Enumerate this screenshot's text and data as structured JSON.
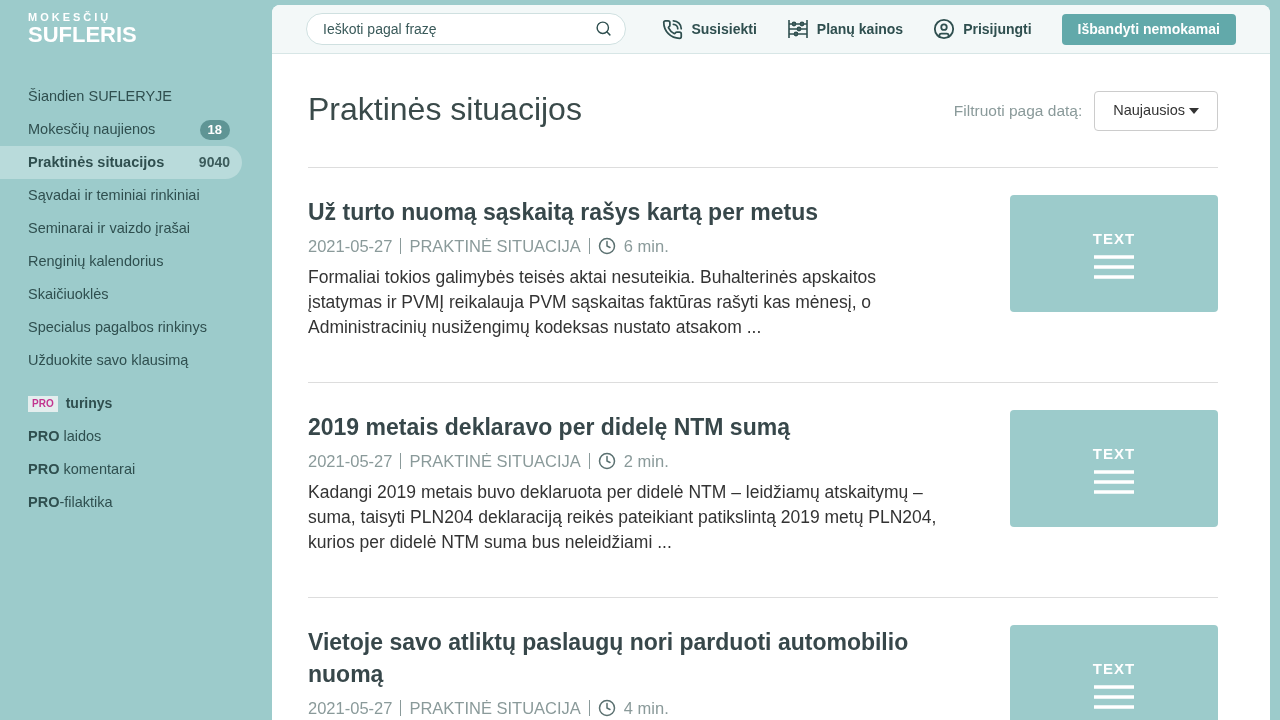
{
  "logo": {
    "top": "MOKESČIŲ",
    "bottom": "SUFLERIS"
  },
  "sidebar": {
    "items": [
      {
        "label": "Šiandien SUFLERYJE",
        "selected": false
      },
      {
        "label": "Mokesčių naujienos",
        "selected": false,
        "count": {
          "text": "18",
          "kind": "pill"
        }
      },
      {
        "label": "Praktinės situacijos",
        "selected": true,
        "count": {
          "text": "9040",
          "kind": "plain"
        }
      },
      {
        "label": "Sąvadai ir teminiai rinkiniai",
        "selected": false
      },
      {
        "label": "Seminarai ir vaizdo įrašai",
        "selected": false
      },
      {
        "label": "Renginių kalendorius",
        "selected": false
      },
      {
        "label": "Skaičiuoklės",
        "selected": false
      },
      {
        "label": "Specialus pagalbos rinkinys",
        "selected": false
      },
      {
        "label": "Užduokite savo klausimą",
        "selected": false
      }
    ],
    "pro_section": {
      "tag": "PRO",
      "title": "turinys",
      "items": [
        "**PRO** laidos",
        "**PRO** komentarai",
        "**PRO**-filaktika"
      ]
    }
  },
  "header": {
    "search": {
      "placeholder": "Ieškoti pagal frazę"
    },
    "links": [
      {
        "label": "Susisiekti",
        "kind": "phone"
      },
      {
        "label": "Planų kainos",
        "kind": "abacus"
      },
      {
        "label": "Prisijungti",
        "kind": "user"
      }
    ],
    "cta": "Išbandyti nemokamai"
  },
  "page": {
    "title": "Praktinės situacijos",
    "filter": {
      "label": "Filtruoti paga datą:",
      "value": "Naujausios"
    }
  },
  "articles": [
    {
      "title": "Už turto nuomą sąskaitą rašys kartą per metus",
      "date": "2021-05-27",
      "category": "PRAKTINĖ SITUACIJA",
      "read_time": "6 min.",
      "excerpt": "Formaliai tokios galimybės teisės aktai nesuteikia. Buhalterinės apskaitos įstatymas ir PVMĮ reikalauja PVM sąskaitas faktūras rašyti kas mėnesį, o Administracinių nusižengimų kodeksas nustato atsakom ...",
      "thumb": "TEXT"
    },
    {
      "title": "2019 metais deklaravo per didelę NTM sumą",
      "date": "2021-05-27",
      "category": "PRAKTINĖ SITUACIJA",
      "read_time": "2 min.",
      "excerpt": "Kadangi 2019 metais buvo deklaruota per didelė NTM – leidžiamų atskaitymų – suma, taisyti PLN204 deklaraciją reikės pateikiant patikslintą 2019 metų PLN204, kurios per didelė NTM suma bus neleidžiami ...",
      "thumb": "TEXT"
    },
    {
      "title": "Vietoje savo atliktų paslaugų nori parduoti automobilio nuomą",
      "date": "2021-05-27",
      "category": "PRAKTINĖ SITUACIJA",
      "read_time": "4 min.",
      "thumb": "TEXT"
    }
  ]
}
